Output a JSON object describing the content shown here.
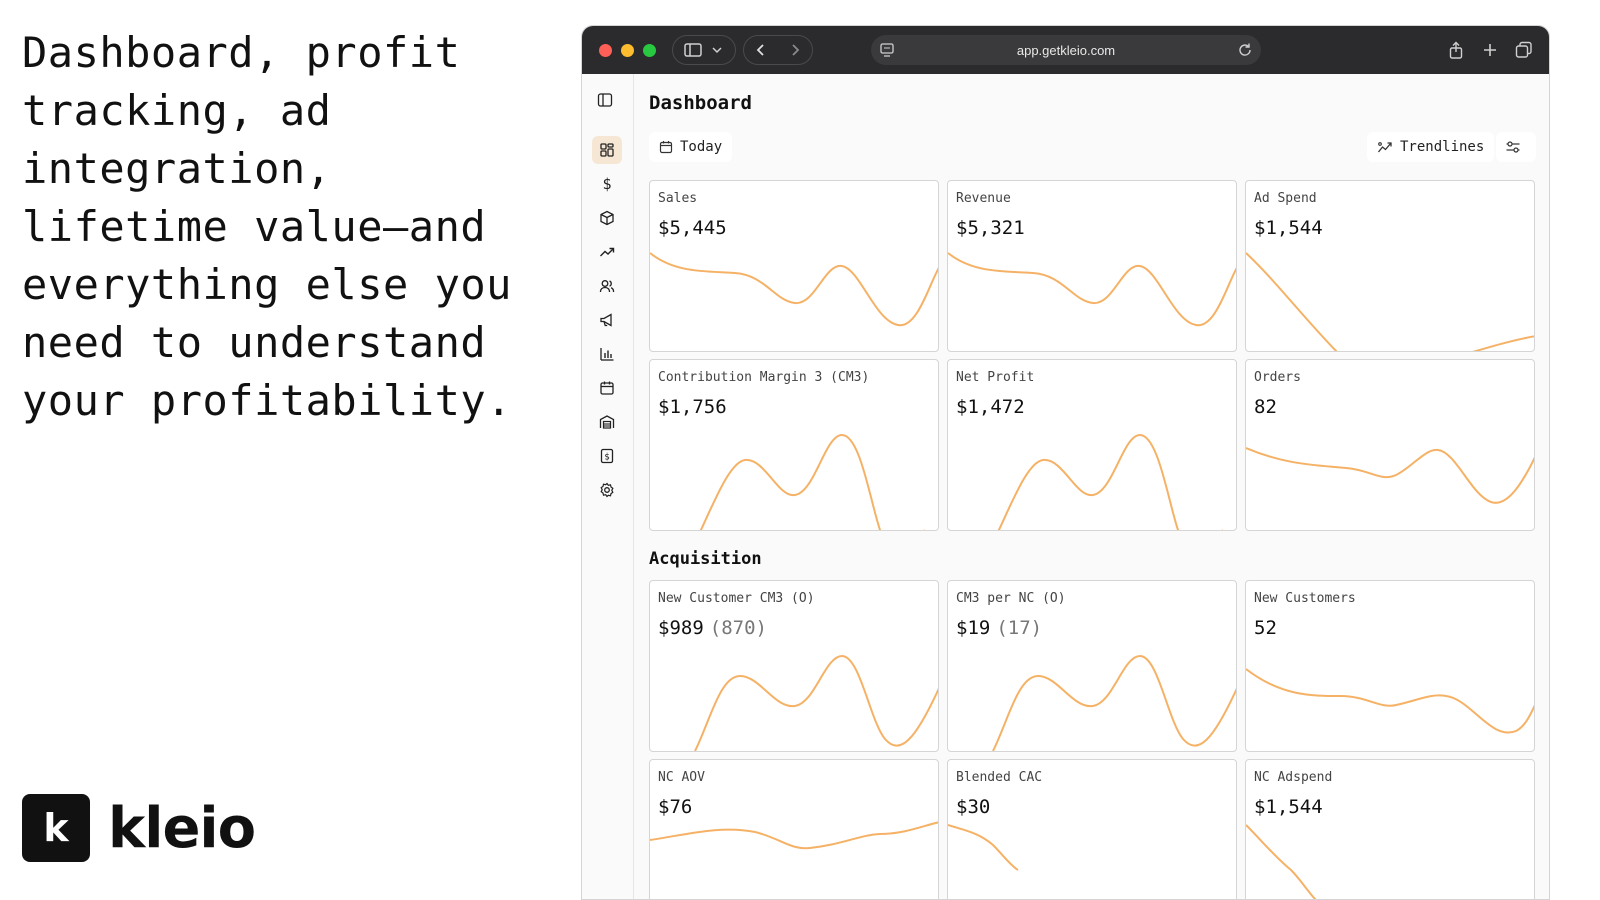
{
  "headline": "Dashboard, profit tracking, ad integration, lifetime value—and everything else you need to understand your profitability.",
  "brand": {
    "mark": "k",
    "name": "kleio"
  },
  "browser": {
    "url": "app.getkleio.com",
    "toolbar_icons": [
      "sidebar-toggle-icon",
      "chevron-down-icon",
      "back-icon",
      "forward-icon",
      "reader-icon",
      "reload-icon",
      "share-icon",
      "new-tab-icon",
      "tabs-overview-icon"
    ]
  },
  "sidebar": {
    "items": [
      {
        "name": "dashboard",
        "icon": "grid-icon",
        "active": true
      },
      {
        "name": "revenue",
        "icon": "dollar-icon"
      },
      {
        "name": "products",
        "icon": "box-icon"
      },
      {
        "name": "trends",
        "icon": "trend-up-icon"
      },
      {
        "name": "customers",
        "icon": "users-icon"
      },
      {
        "name": "marketing",
        "icon": "megaphone-icon"
      },
      {
        "name": "reports",
        "icon": "bar-chart-icon"
      },
      {
        "name": "calendar",
        "icon": "calendar-icon"
      },
      {
        "name": "warehouse",
        "icon": "warehouse-icon"
      },
      {
        "name": "invoices",
        "icon": "invoice-icon"
      },
      {
        "name": "settings",
        "icon": "gear-icon"
      }
    ]
  },
  "page": {
    "title": "Dashboard",
    "date_filter": "Today",
    "trendlines_label": "Trendlines",
    "accent_color": "#f5b266",
    "section_acquisition": "Acquisition"
  },
  "cards": [
    {
      "label": "Sales",
      "value": "$5,445",
      "sub": ""
    },
    {
      "label": "Revenue",
      "value": "$5,321",
      "sub": ""
    },
    {
      "label": "Ad Spend",
      "value": "$1,544",
      "sub": ""
    },
    {
      "label": "Contribution Margin 3 (CM3)",
      "value": "$1,756",
      "sub": ""
    },
    {
      "label": "Net Profit",
      "value": "$1,472",
      "sub": ""
    },
    {
      "label": "Orders",
      "value": "82",
      "sub": ""
    },
    {
      "label": "New Customer CM3 (O)",
      "value": "$989",
      "sub": "(870)"
    },
    {
      "label": "CM3 per NC (O)",
      "value": "$19",
      "sub": "(17)"
    },
    {
      "label": "New Customers",
      "value": "52",
      "sub": ""
    },
    {
      "label": "NC AOV",
      "value": "$76",
      "sub": ""
    },
    {
      "label": "Blended CAC",
      "value": "$30",
      "sub": ""
    },
    {
      "label": "NC Adspend",
      "value": "$1,544",
      "sub": ""
    }
  ]
}
